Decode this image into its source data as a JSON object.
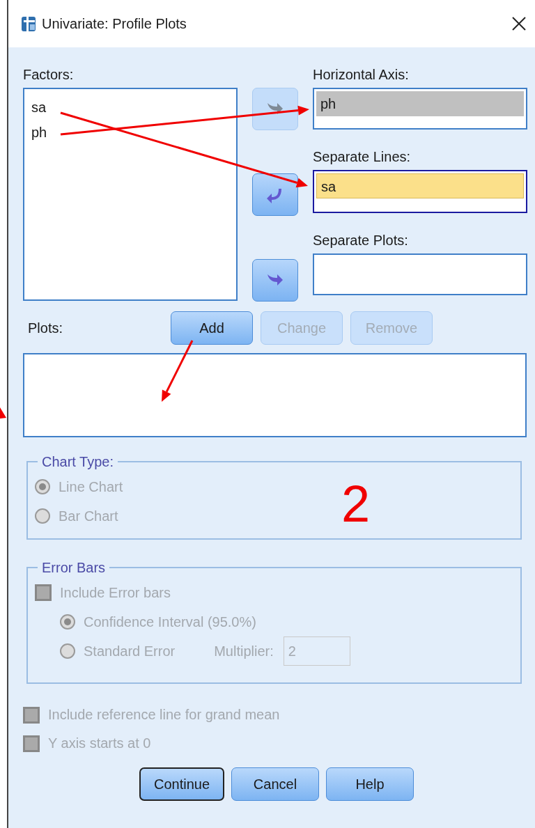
{
  "window": {
    "title": "Univariate: Profile Plots"
  },
  "factors": {
    "label": "Factors:",
    "items": [
      {
        "text": "sa"
      },
      {
        "text": "ph"
      }
    ]
  },
  "move_buttons": [
    {
      "kind": "forward",
      "disabled": true
    },
    {
      "kind": "back",
      "disabled": false
    },
    {
      "kind": "forward",
      "disabled": false
    }
  ],
  "targets": [
    {
      "label": "Horizontal Axis:",
      "focused": false,
      "items": [
        {
          "text": "ph",
          "selected": true
        }
      ]
    },
    {
      "label": "Separate Lines:",
      "focused": true,
      "items": [
        {
          "text": "sa",
          "selected": true
        }
      ]
    },
    {
      "label": "Separate Plots:",
      "focused": false
    }
  ],
  "plots": {
    "label": "Plots:",
    "buttons": [
      {
        "label": "Add",
        "disabled": false
      },
      {
        "label": "Change",
        "disabled": true
      },
      {
        "label": "Remove",
        "disabled": true
      }
    ]
  },
  "chart_type": {
    "label": "Chart Type:",
    "disabled": true,
    "options": [
      {
        "label": "Line Chart",
        "selected": true
      },
      {
        "label": "Bar Chart",
        "selected": false
      }
    ]
  },
  "error_bars": {
    "label": "Error Bars",
    "disabled": true,
    "include": {
      "label": "Include Error bars",
      "checked": false
    },
    "options": [
      {
        "label": "Confidence Interval (95.0%)",
        "selected": true
      },
      {
        "label": "Standard Error",
        "selected": false
      }
    ],
    "multiplier": {
      "label": "Multiplier:",
      "value": "2"
    }
  },
  "checkboxes": [
    {
      "label": "Include reference line for grand mean",
      "checked": false,
      "disabled": true
    },
    {
      "label": "Y axis starts at 0",
      "checked": false,
      "disabled": true
    }
  ],
  "buttons": [
    {
      "label": "Continue",
      "default": true
    },
    {
      "label": "Cancel",
      "default": false
    },
    {
      "label": "Help",
      "default": false
    }
  ],
  "annotation": {
    "text": "2"
  }
}
